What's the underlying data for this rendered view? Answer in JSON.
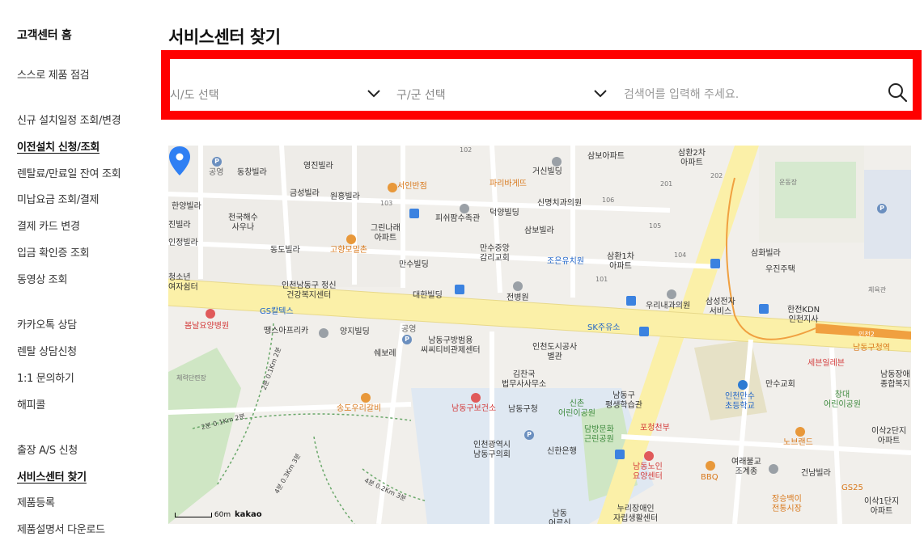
{
  "sidebar": {
    "items": [
      {
        "label": "고객센터 홈"
      },
      {
        "label": "스스로 제품 점검"
      },
      {
        "label": "신규 설치일정 조회/변경"
      },
      {
        "label": "이전설치 신청/조회"
      },
      {
        "label": "렌탈료/만료일 잔여 조회"
      },
      {
        "label": "미납요금 조회/결제"
      },
      {
        "label": "결제 카드 변경"
      },
      {
        "label": "입금 확인증 조회"
      },
      {
        "label": "동영상 조회"
      },
      {
        "label": "카카오톡 상담"
      },
      {
        "label": "렌탈 상담신청"
      },
      {
        "label": "1:1 문의하기"
      },
      {
        "label": "해피콜"
      },
      {
        "label": "출장 A/S 신청"
      },
      {
        "label": "서비스센터 찾기"
      },
      {
        "label": "제품등록"
      },
      {
        "label": "제품설명서 다운로드"
      }
    ]
  },
  "main": {
    "title": "서비스센터 찾기",
    "search": {
      "city_select": "시/도 선택",
      "district_select": "구/군 선택",
      "placeholder": "검색어를 입력해 주세요."
    }
  },
  "map": {
    "labels": [
      {
        "text": "공영"
      },
      {
        "text": "동창빌라"
      },
      {
        "text": "영진빌라"
      },
      {
        "text": "금성빌라"
      },
      {
        "text": "원흥빌라"
      },
      {
        "text": "한양빌라"
      },
      {
        "text": "천국해수\n사우나"
      },
      {
        "text": "진빌라"
      },
      {
        "text": "인정빌라"
      },
      {
        "text": "동도빌라"
      },
      {
        "text": "고향모밀촌"
      },
      {
        "text": "그린나래\n아파트"
      },
      {
        "text": "서인반점"
      },
      {
        "text": "파리바게뜨"
      },
      {
        "text": "피쉬팜수족관"
      },
      {
        "text": "덕양빌딩"
      },
      {
        "text": "거신빌딩"
      },
      {
        "text": "삼보아파트"
      },
      {
        "text": "신명치과의원"
      },
      {
        "text": "삼보빌라"
      },
      {
        "text": "만수중앙\n감리교회"
      },
      {
        "text": "만수빌딩"
      },
      {
        "text": "조은유치원"
      },
      {
        "text": "삼환1차\n아파트"
      },
      {
        "text": "삼환2차\n아파트"
      },
      {
        "text": "운동장"
      },
      {
        "text": "삼화빌라"
      },
      {
        "text": "우진주택"
      },
      {
        "text": "체육관"
      },
      {
        "text": "청소년\n여자쉼터"
      },
      {
        "text": "인천남동구 정신\n건강복지센터"
      },
      {
        "text": "대한빌딩"
      },
      {
        "text": "전병원"
      },
      {
        "text": "우리내과의원"
      },
      {
        "text": "삼성전자\n서비스"
      },
      {
        "text": "한전KDN\n인천지사"
      },
      {
        "text": "GS칼텍스"
      },
      {
        "text": "봄날요양병원"
      },
      {
        "text": "땡스아프리카"
      },
      {
        "text": "양지빌딩"
      },
      {
        "text": "공영"
      },
      {
        "text": "쉐보레"
      },
      {
        "text": "남동구방범용\n씨씨티비관제센터"
      },
      {
        "text": "인천도시공사\n별관"
      },
      {
        "text": "SK주유소"
      },
      {
        "text": "인천2"
      },
      {
        "text": "남동구청역"
      },
      {
        "text": "세븐일레븐"
      },
      {
        "text": "만수교회"
      },
      {
        "text": "남동장애\n종합복지"
      },
      {
        "text": "인천만수\n초등학교"
      },
      {
        "text": "창대\n어린이공원"
      },
      {
        "text": "체력단련장"
      },
      {
        "text": "김찬국\n법무사사무소"
      },
      {
        "text": "송도우리갈비"
      },
      {
        "text": "남동구보건소"
      },
      {
        "text": "남동구청"
      },
      {
        "text": "신촌\n어린이공원"
      },
      {
        "text": "남동구\n평생학습관"
      },
      {
        "text": "포청천부"
      },
      {
        "text": "담방문화\n근린공원"
      },
      {
        "text": "인천광역시\n남동구의회"
      },
      {
        "text": "신한은행"
      },
      {
        "text": "노브랜드"
      },
      {
        "text": "이삭2단지\n아파트"
      },
      {
        "text": "여래불교\n조계종"
      },
      {
        "text": "BBQ"
      },
      {
        "text": "건남빌라"
      },
      {
        "text": "남동노인\n요양센터"
      },
      {
        "text": "장승백이\n전통시장"
      },
      {
        "text": "GS25"
      },
      {
        "text": "이삭1단지\n아파트"
      },
      {
        "text": "누리장애인\n자립생활센터"
      },
      {
        "text": "남동\n어르신\n"
      },
      {
        "text": "101"
      },
      {
        "text": "102"
      },
      {
        "text": "103"
      },
      {
        "text": "104"
      },
      {
        "text": "105"
      },
      {
        "text": "106"
      },
      {
        "text": "201"
      },
      {
        "text": "202"
      }
    ],
    "paths": [
      {
        "text": "2분 0.1Km 2분"
      },
      {
        "text": "2분 0.1Km 2분"
      },
      {
        "text": "4분 0.3Km 3분"
      },
      {
        "text": "4분 0.2Km 3분"
      }
    ],
    "scale_label": "60m",
    "brand": "kakao"
  }
}
